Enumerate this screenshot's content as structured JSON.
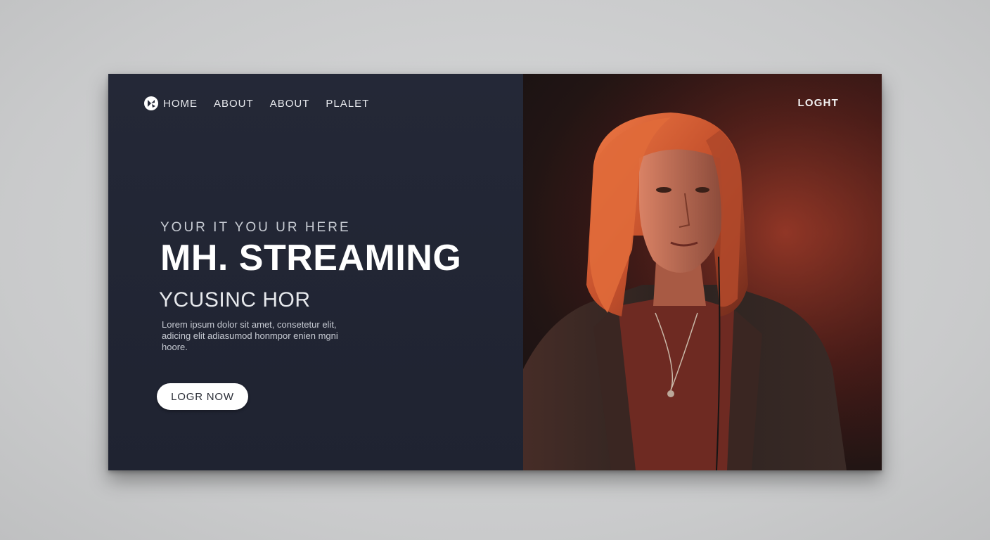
{
  "nav": {
    "items": [
      {
        "label": "HOME"
      },
      {
        "label": "ABOUT"
      },
      {
        "label": "ABOUT"
      },
      {
        "label": "PLALET"
      }
    ],
    "login_label": "LOGHT"
  },
  "hero": {
    "eyebrow": "YOUR IT YOU UR HERE",
    "headline": "MH. STREAMING",
    "subheadline": "YCUSINC HOR",
    "body": "Lorem ipsum dolor sit amet, consetetur elit, adicing elit adiasumod honmpor enien mgni hoore.",
    "cta_label": "LOGR NOW"
  },
  "colors": {
    "left_panel": "#222634",
    "accent_red": "#7a2a20",
    "cta_bg": "#ffffff"
  },
  "icons": {
    "logo": "brand-logo-icon"
  }
}
